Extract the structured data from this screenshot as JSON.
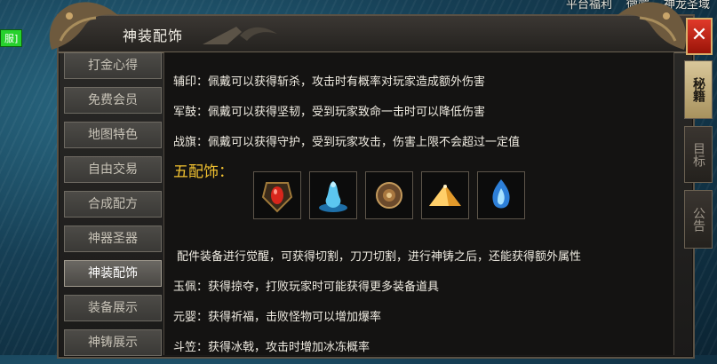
{
  "top_links": [
    "平台福利",
    "微端",
    "神龙圣域"
  ],
  "badge_text": "服]",
  "window": {
    "title": "神装配饰",
    "close_label": "✕"
  },
  "menu": [
    {
      "label": "打金心得"
    },
    {
      "label": "免费会员"
    },
    {
      "label": "地图特色"
    },
    {
      "label": "自由交易"
    },
    {
      "label": "合成配方"
    },
    {
      "label": "神器圣器"
    },
    {
      "label": "神装配饰",
      "active": true
    },
    {
      "label": "装备展示"
    },
    {
      "label": "神铸展示"
    }
  ],
  "right_tabs": [
    {
      "label": "秘籍",
      "active": true
    },
    {
      "label": "目标"
    },
    {
      "label": "公告"
    }
  ],
  "content": {
    "line1": "辅印：佩戴可以获得斩杀，攻击时有概率对玩家造成额外伤害",
    "line2": "军鼓：佩戴可以获得坚韧，受到玩家致命一击时可以降低伤害",
    "line3": "战旗：佩戴可以获得守护，受到玩家攻击，伤害上限不会超过一定值",
    "heading": "五配饰：",
    "icons": [
      "red-gem-amulet-icon",
      "blue-spirit-figure-icon",
      "round-shield-medal-icon",
      "golden-pyramid-icon",
      "blue-flame-orb-icon"
    ],
    "line4": "配件装备进行觉醒，可获得切割，刀刀切割，进行神铸之后，还能获得额外属性",
    "line5": "玉佩：获得掠夺，打败玩家时可能获得更多装备道具",
    "line6": "元婴：获得祈福，击败怪物可以增加爆率",
    "line7": "斗笠：获得冰戟，攻击时增加冰冻概率"
  }
}
